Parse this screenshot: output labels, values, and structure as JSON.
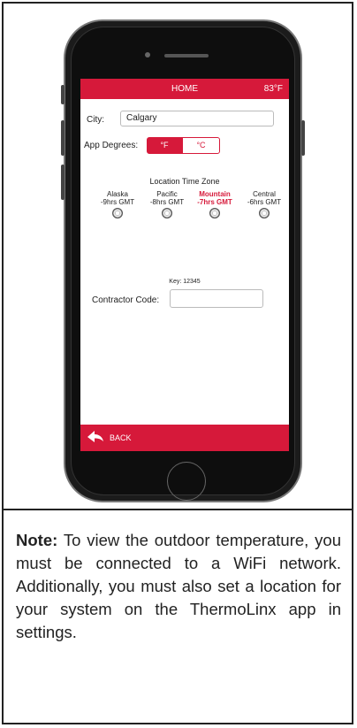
{
  "header": {
    "title": "HOME",
    "temperature": "83°F"
  },
  "city": {
    "label": "City:",
    "value": "Calgary"
  },
  "app_degrees": {
    "label": "App Degrees:",
    "options": [
      "°F",
      "°C"
    ],
    "selected": "°F"
  },
  "timezone": {
    "title": "Location Time Zone",
    "zones": [
      {
        "name": "Alaska",
        "offset": "-9hrs  GMT",
        "active": false
      },
      {
        "name": "Pacific",
        "offset": "-8hrs  GMT",
        "active": false
      },
      {
        "name": "Mountain",
        "offset": "-7hrs  GMT",
        "active": true
      },
      {
        "name": "Central",
        "offset": "-6hrs  GMT",
        "active": false
      }
    ]
  },
  "key": "Key: 12345",
  "contractor": {
    "label": "Contractor Code:",
    "value": ""
  },
  "footer": {
    "back_label": "BACK"
  },
  "note": {
    "prefix": "Note:",
    "text": " To view the outdoor temperature, you must be connected to a WiFi network. Additionally, you must also set a location for your system on the ThermoLinx app in settings."
  },
  "colors": {
    "accent": "#d6193a"
  }
}
